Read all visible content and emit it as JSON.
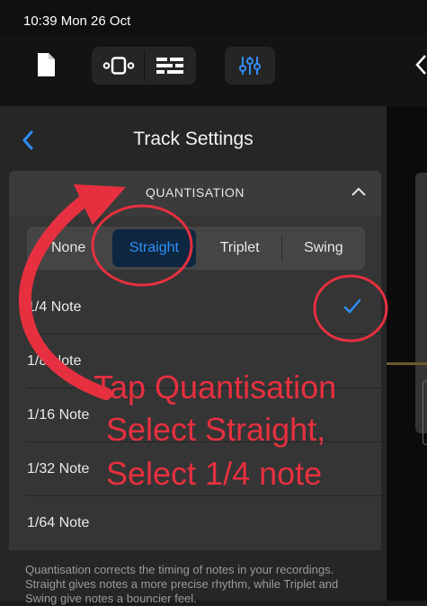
{
  "status_bar": {
    "time": "10:39  Mon 26 Oct"
  },
  "toolbar": {
    "document_icon": "document-icon",
    "loop_icon": "loop-browser-icon",
    "tracks_icon": "tracks-view-icon",
    "mixer_icon": "mixer-sliders-icon",
    "back_icon": "chevron-left-icon"
  },
  "panel": {
    "title": "Track Settings",
    "section_title": "QUANTISATION",
    "segments": [
      "None",
      "Straight",
      "Triplet",
      "Swing"
    ],
    "selected_segment": "Straight",
    "notes": [
      "1/4 Note",
      "1/8 Note",
      "1/16 Note",
      "1/32 Note",
      "1/64 Note"
    ],
    "selected_note": "1/4 Note",
    "footer": "Quantisation corrects the timing of notes in your recordings. Straight gives notes a more precise rhythm, while Triplet and Swing give notes a bouncier feel."
  },
  "annotation": {
    "line1": "Tap Quantisation",
    "line2": "Select Straight,",
    "line3": "Select 1/4 note",
    "color": "#e6303f"
  },
  "colors": {
    "accent": "#2f8ef7",
    "selected_segment_bg": "#0e2740",
    "panel_bg": "#262626",
    "card_bg": "#353535"
  }
}
